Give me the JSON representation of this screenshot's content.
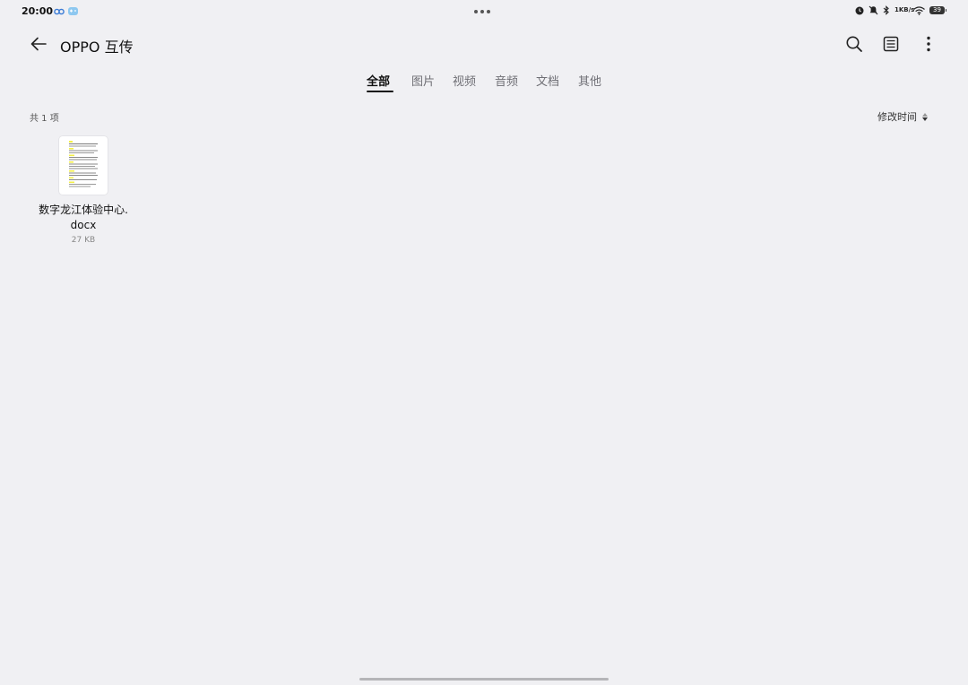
{
  "status_bar": {
    "time": "20:00",
    "left_icons": [
      "link-icon",
      "gamepad-icon"
    ],
    "network_speed": "1KB/s",
    "battery": "39",
    "right_icons": [
      "alarm-icon",
      "mute-icon",
      "bluetooth-icon",
      "wifi-icon",
      "battery-icon"
    ]
  },
  "app_bar": {
    "title": "OPPO 互传",
    "icons": [
      "back-arrow-icon",
      "search-icon",
      "list-view-icon",
      "more-icon"
    ]
  },
  "tabs": [
    {
      "label": "全部",
      "active": true
    },
    {
      "label": "图片",
      "active": false
    },
    {
      "label": "视频",
      "active": false
    },
    {
      "label": "音频",
      "active": false
    },
    {
      "label": "文档",
      "active": false
    },
    {
      "label": "其他",
      "active": false
    }
  ],
  "summary": {
    "count": "共 1 项",
    "sort_label": "修改时间"
  },
  "files": [
    {
      "name": "数字龙江体验中心.docx",
      "size": "27 KB",
      "icon": "document-thumbnail-icon"
    }
  ],
  "colors": {
    "background": "#f0f0f3",
    "text_primary": "#111111",
    "text_secondary": "#6f6f75",
    "highlight": "#f3f04a"
  }
}
